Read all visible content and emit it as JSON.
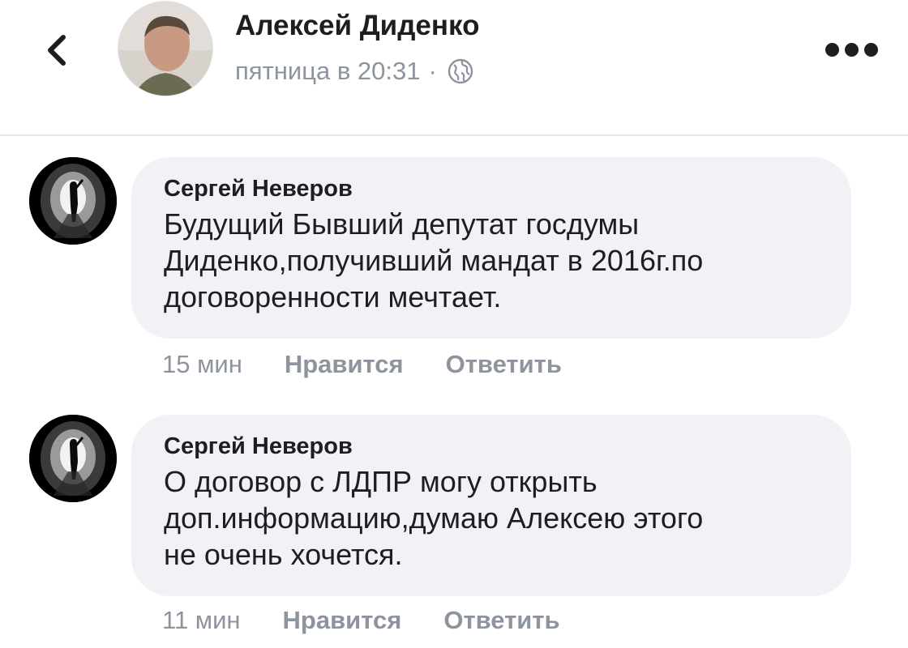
{
  "post_header": {
    "author_name": "Алексей Диденко",
    "timestamp": "пятница в 20:31",
    "separator": "·",
    "privacy_icon": "globe-icon",
    "back_icon": "chevron-left-icon",
    "more_icon": "more-horizontal-icon"
  },
  "comments": [
    {
      "author": "Сергей Неверов",
      "text": "Будущий Бывший депутат госдумы\nДиденко,получивший мандат в 2016г.по\nдоговоренности мечтает.",
      "time": "15 мин",
      "like_label": "Нравится",
      "reply_label": "Ответить"
    },
    {
      "author": "Сергей Неверов",
      "text": "О договор с ЛДПР могу  открыть\nдоп.информацию,думаю Алексею этого\nне очень хочется.",
      "time": "11 мин",
      "like_label": "Нравится",
      "reply_label": "Ответить"
    }
  ],
  "colors": {
    "bubble_bg": "#f0f2f5",
    "primary_text": "#1c1e21",
    "secondary_text": "#8d949e",
    "divider": "#e4e6ea"
  }
}
